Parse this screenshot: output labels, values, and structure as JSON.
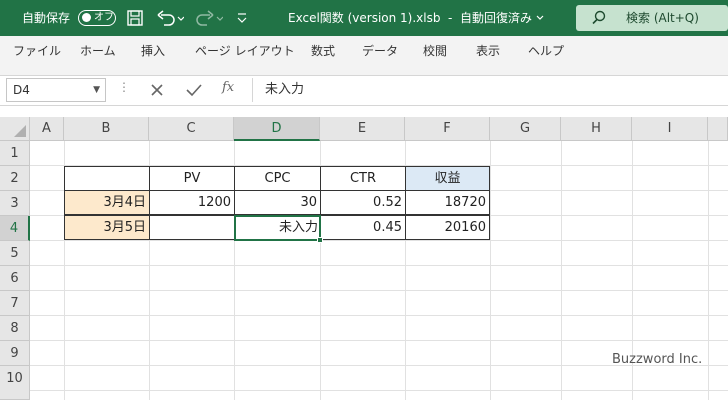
{
  "titlebar": {
    "autosave_label": "自動保存",
    "autosave_state": "オフ",
    "qat_save_icon": "save-icon",
    "qat_undo_icon": "undo-icon",
    "qat_redo_icon": "redo-icon",
    "qat_more_icon": "customize-qat-icon",
    "doc_title": "Excel関数 (version 1).xlsb",
    "save_status": "自動回復済み",
    "search_label": "検索 (Alt+Q)",
    "accent": "#217346"
  },
  "ribbon": {
    "tabs": [
      "ファイル",
      "ホーム",
      "挿入",
      "ページ レイアウト",
      "数式",
      "データ",
      "校閲",
      "表示",
      "ヘルプ"
    ]
  },
  "formula_bar": {
    "name_box": "D4",
    "cancel_icon": "cancel-icon",
    "enter_icon": "check-icon",
    "function_icon": "fx-icon",
    "fx_label": "fx",
    "content": "未入力"
  },
  "grid": {
    "columns": [
      "A",
      "B",
      "C",
      "D",
      "E",
      "F",
      "G",
      "H",
      "I"
    ],
    "rows": [
      "1",
      "2",
      "3",
      "4",
      "5",
      "6",
      "7",
      "8",
      "9",
      "10"
    ],
    "active_column": "D",
    "active_row": "4"
  },
  "table": {
    "headers": [
      "PV",
      "CPC",
      "CTR",
      "収益"
    ],
    "rows": [
      {
        "date": "3月4日",
        "pv": "1200",
        "cpc": "30",
        "ctr": "0.52",
        "revenue": "18720"
      },
      {
        "date": "3月5日",
        "cpc_text": "未入力",
        "ctr": "0.45",
        "revenue": "20160"
      }
    ],
    "date_fill": "#fde9cc",
    "header_highlight": "#dce9f5"
  },
  "watermark": "Buzzword Inc."
}
